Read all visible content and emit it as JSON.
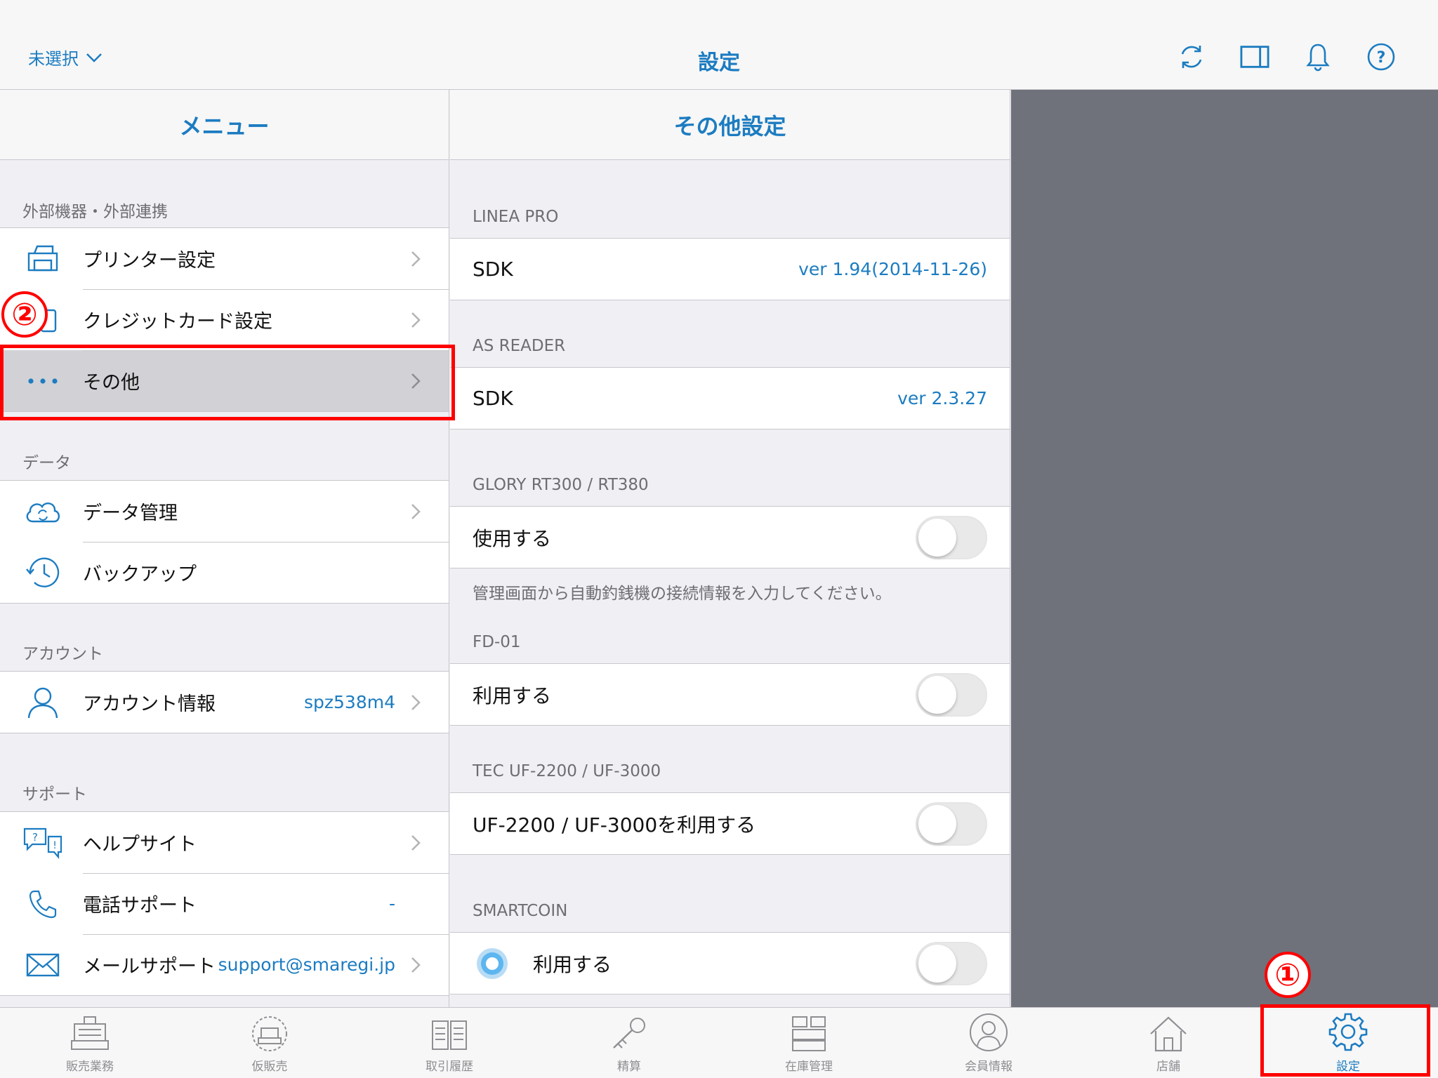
{
  "header": {
    "store_selector": "未選択",
    "title": "設定"
  },
  "menu": {
    "title": "メニュー",
    "sections": [
      {
        "label": "外部機器・外部連携",
        "items": [
          {
            "label": "プリンター設定",
            "icon": "printer-icon",
            "value": ""
          },
          {
            "label": "クレジットカード設定",
            "icon": "card-reader-icon",
            "value": ""
          },
          {
            "label": "その他",
            "icon": "more-dots-icon",
            "value": "",
            "selected": true
          }
        ]
      },
      {
        "label": "データ",
        "items": [
          {
            "label": "データ管理",
            "icon": "cloud-sync-icon",
            "value": ""
          },
          {
            "label": "バックアップ",
            "icon": "history-clock-icon",
            "value": ""
          }
        ]
      },
      {
        "label": "アカウント",
        "items": [
          {
            "label": "アカウント情報",
            "icon": "user-icon",
            "value": "spz538m4"
          }
        ]
      },
      {
        "label": "サポート",
        "items": [
          {
            "label": "ヘルプサイト",
            "icon": "help-chat-icon",
            "value": ""
          },
          {
            "label": "電話サポート",
            "icon": "phone-icon",
            "value": "-"
          },
          {
            "label": "メールサポート",
            "icon": "mail-icon",
            "value": "support@smaregi.jp"
          }
        ]
      }
    ]
  },
  "detail": {
    "title": "その他設定",
    "linea_pro": {
      "header": "LINEA PRO",
      "label": "SDK",
      "value": "ver 1.94(2014-11-26)"
    },
    "as_reader": {
      "header": "AS READER",
      "label": "SDK",
      "value": "ver 2.3.27"
    },
    "glory": {
      "header": "GLORY RT300 / RT380",
      "label": "使用する",
      "note": "管理画面から自動釣銭機の接続情報を入力してください。"
    },
    "fd01": {
      "header": "FD-01",
      "label": "利用する"
    },
    "tec": {
      "header": "TEC UF-2200 / UF-3000",
      "label": "UF-2200 / UF-3000を利用する"
    },
    "smartcoin": {
      "header": "SMARTCOIN",
      "label": "利用する"
    }
  },
  "tabs": [
    {
      "label": "販売業務",
      "icon": "register-icon"
    },
    {
      "label": "仮販売",
      "icon": "temp-register-icon"
    },
    {
      "label": "取引履歴",
      "icon": "history-book-icon"
    },
    {
      "label": "精算",
      "icon": "key-icon"
    },
    {
      "label": "在庫管理",
      "icon": "inventory-icon"
    },
    {
      "label": "会員情報",
      "icon": "member-icon"
    },
    {
      "label": "店舗",
      "icon": "store-icon"
    },
    {
      "label": "設定",
      "icon": "gear-icon",
      "active": true
    }
  ],
  "annotations": {
    "marker_1": "①",
    "marker_2": "②"
  },
  "colors": {
    "accent": "#1c7cc1",
    "highlight": "#ff0000",
    "side_panel": "#6f727a"
  }
}
